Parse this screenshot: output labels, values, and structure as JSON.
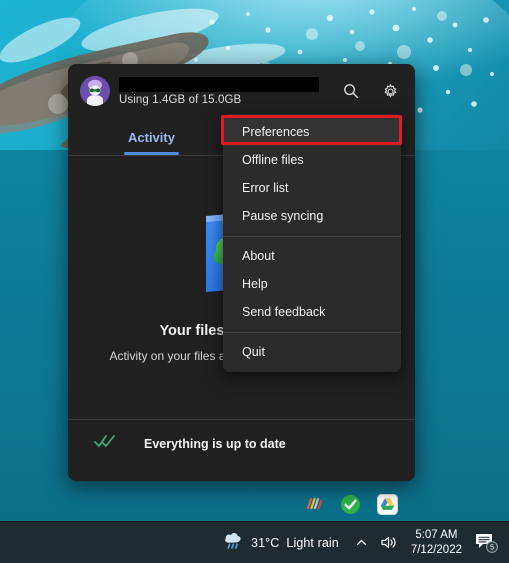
{
  "desktop": {
    "wallpaper_description": "underwater-dolphins-bubbles",
    "wallpaper_colors": {
      "deep": "#0e6e86",
      "mid": "#1aa6c4",
      "light": "#7fd9ea",
      "foam": "#dff4fa",
      "dolphin": "#6f6a62"
    }
  },
  "onedrive": {
    "account": {
      "avatar_name": "user-avatar",
      "name_redacted": true,
      "storage_text": "Using 1.4GB of 15.0GB"
    },
    "header_actions": [
      {
        "name": "search-icon",
        "label": "Search"
      },
      {
        "name": "gear-icon",
        "label": "Settings"
      }
    ],
    "tabs": [
      {
        "label": "Activity",
        "selected": true
      }
    ],
    "empty_state": {
      "illustration": "blue-square-green-cloud-check-icon",
      "title": "Your files are up to date",
      "subtitle": "Activity on your files and folders will show up here"
    },
    "status": {
      "icon": "double-check-icon",
      "text": "Everything is up to date",
      "icon_color": "#3fa873"
    }
  },
  "menu": {
    "highlight_color": "#e01b24",
    "groups": [
      {
        "items": [
          {
            "label": "Preferences",
            "highlighted": true
          },
          {
            "label": "Offline files",
            "highlighted": false
          },
          {
            "label": "Error list",
            "highlighted": false
          },
          {
            "label": "Pause syncing",
            "highlighted": false
          }
        ]
      },
      {
        "items": [
          {
            "label": "About",
            "highlighted": false
          },
          {
            "label": "Help",
            "highlighted": false
          },
          {
            "label": "Send feedback",
            "highlighted": false
          }
        ]
      },
      {
        "items": [
          {
            "label": "Quit",
            "highlighted": false
          }
        ]
      }
    ]
  },
  "tray_flyout": {
    "icons": [
      {
        "name": "wondershare-icon",
        "label": "Wondershare"
      },
      {
        "name": "onedrive-synced-icon",
        "label": "OneDrive - up to date"
      },
      {
        "name": "google-drive-icon",
        "label": "Google Drive"
      }
    ]
  },
  "taskbar": {
    "weather": {
      "icon": "rain-cloud-icon",
      "temperature": "31°C",
      "condition": "Light rain"
    },
    "show_hidden_icons": {
      "name": "chevron-up-icon",
      "label": "Show hidden icons"
    },
    "volume": {
      "name": "speaker-icon",
      "label": "Volume"
    },
    "clock": {
      "time": "5:07 AM",
      "date": "7/12/2022"
    },
    "notifications": {
      "icon": "chat-notification-icon",
      "count": "5"
    }
  }
}
